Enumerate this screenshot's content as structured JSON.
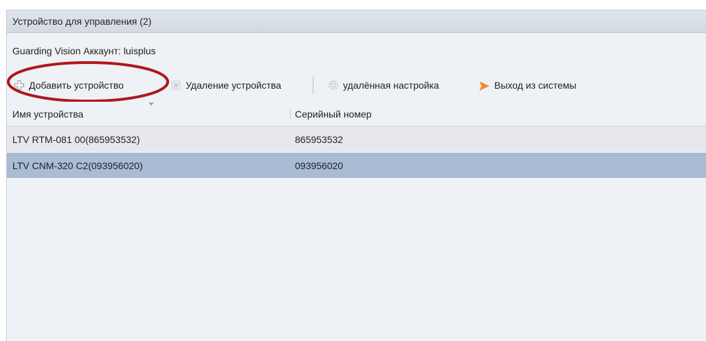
{
  "window": {
    "title": "Устройство для управления (2)"
  },
  "account": {
    "label": "Guarding Vision Аккаунт:",
    "username": "luisplus"
  },
  "toolbar": {
    "add_device": {
      "label": "Добавить устройство",
      "icon": "plus-icon",
      "enabled": true,
      "highlighted": true
    },
    "delete_device": {
      "label": "Удаление устройства",
      "icon": "delete-icon",
      "enabled": false
    },
    "remote_settings": {
      "label": "удалённая настройка",
      "icon": "gear-icon",
      "enabled": false
    },
    "logout": {
      "label": "Выход из системы",
      "icon": "logout-arrow-icon",
      "enabled": true
    }
  },
  "table": {
    "columns": [
      "Имя устройства",
      "Серийный номер"
    ],
    "rows": [
      {
        "name": "LTV RTM-081 00(865953532)",
        "serial": "865953532",
        "selected": false
      },
      {
        "name": "LTV CNM-320 C2(093956020)",
        "serial": "093956020",
        "selected": true
      }
    ]
  },
  "colors": {
    "panel_bg": "#eef1f6",
    "selected_row": "#a9bcd4",
    "highlight_ellipse": "#b0171b",
    "logout_icon": "#f08c1c"
  }
}
